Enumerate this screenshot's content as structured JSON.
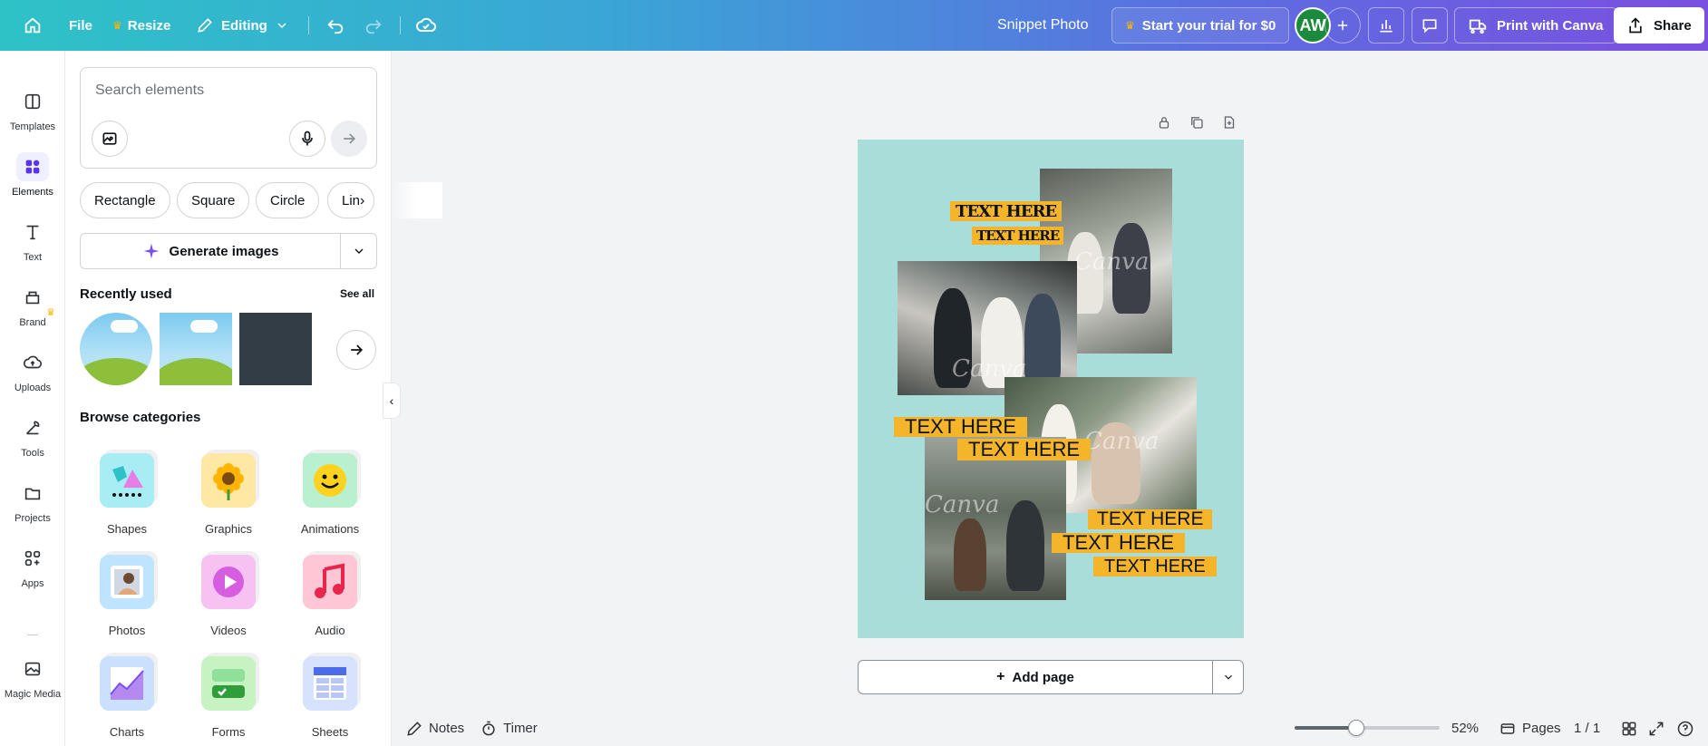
{
  "topbar": {
    "file_label": "File",
    "resize_label": "Resize",
    "editing_label": "Editing",
    "document_title": "Snippet Photo",
    "trial_label": "Start your trial for $0",
    "avatar_initials": "AW",
    "print_label": "Print with Canva",
    "share_label": "Share"
  },
  "rail": {
    "items": [
      {
        "label": "Templates",
        "icon": "templates-icon"
      },
      {
        "label": "Elements",
        "icon": "elements-icon"
      },
      {
        "label": "Text",
        "icon": "text-icon"
      },
      {
        "label": "Brand",
        "icon": "brand-icon"
      },
      {
        "label": "Uploads",
        "icon": "uploads-icon"
      },
      {
        "label": "Tools",
        "icon": "tools-icon"
      },
      {
        "label": "Projects",
        "icon": "projects-icon"
      },
      {
        "label": "Apps",
        "icon": "apps-icon"
      },
      {
        "label": "Magic Media",
        "icon": "magic-media-icon"
      }
    ],
    "active": "Elements"
  },
  "panel": {
    "search_placeholder": "Search elements",
    "chips": [
      "Rectangle",
      "Square",
      "Circle",
      "Lin"
    ],
    "generate_label": "Generate images",
    "recently_used_title": "Recently used",
    "see_all_label": "See all",
    "browse_title": "Browse categories",
    "categories": [
      "Shapes",
      "Graphics",
      "Animations",
      "Photos",
      "Videos",
      "Audio",
      "Charts",
      "Forms",
      "Sheets"
    ]
  },
  "canvas": {
    "watermark": "Canva",
    "text_tags": [
      "TEXT HERE",
      "TEXT HERE",
      "TEXT HERE",
      "TEXT HERE",
      "TEXT HERE",
      "TEXT HERE",
      "TEXT HERE"
    ],
    "add_page_label": "Add page",
    "background_color": "#a9ddd9",
    "tag_color": "#f5b52a"
  },
  "bottombar": {
    "notes_label": "Notes",
    "timer_label": "Timer",
    "zoom_value": "52%",
    "zoom_fraction": 0.52,
    "pages_label": "Pages",
    "page_indicator": "1 / 1"
  },
  "colors": {
    "accent": "#5a32fa",
    "trial_crown": "#ffb400",
    "avatar_bg": "#1c8a3c"
  }
}
